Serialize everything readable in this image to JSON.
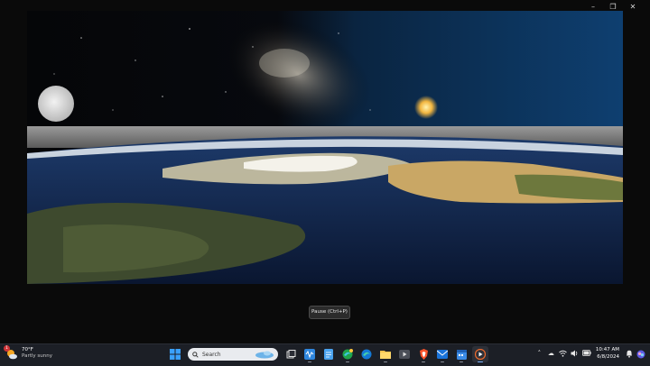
{
  "window": {
    "controls": {
      "minimize": "–",
      "maximize": "❐",
      "close": "✕"
    }
  },
  "player": {
    "tooltip": "Pause (Ctrl+P)"
  },
  "taskbar": {
    "weather": {
      "temp": "70°F",
      "condition": "Partly sunny",
      "badge": "1"
    },
    "search_placeholder": "Search",
    "apps": [
      {
        "name": "windows-start",
        "active": false
      },
      {
        "name": "task-view",
        "active": false
      },
      {
        "name": "app-wave",
        "active": false
      },
      {
        "name": "notepad",
        "active": false
      },
      {
        "name": "edge-beta",
        "active": false
      },
      {
        "name": "edge",
        "active": false
      },
      {
        "name": "file-explorer",
        "active": false
      },
      {
        "name": "media-app",
        "active": false
      },
      {
        "name": "brave",
        "active": false
      },
      {
        "name": "mail",
        "active": false
      },
      {
        "name": "calendar",
        "active": false
      },
      {
        "name": "media-player",
        "active": true
      }
    ],
    "tray": {
      "time": "10:47 AM",
      "date": "6/8/2024"
    }
  },
  "colors": {
    "taskbar_bg": "#1c1f26",
    "accent": "#7fb4ff",
    "sky_blue": "#0d3a66"
  }
}
